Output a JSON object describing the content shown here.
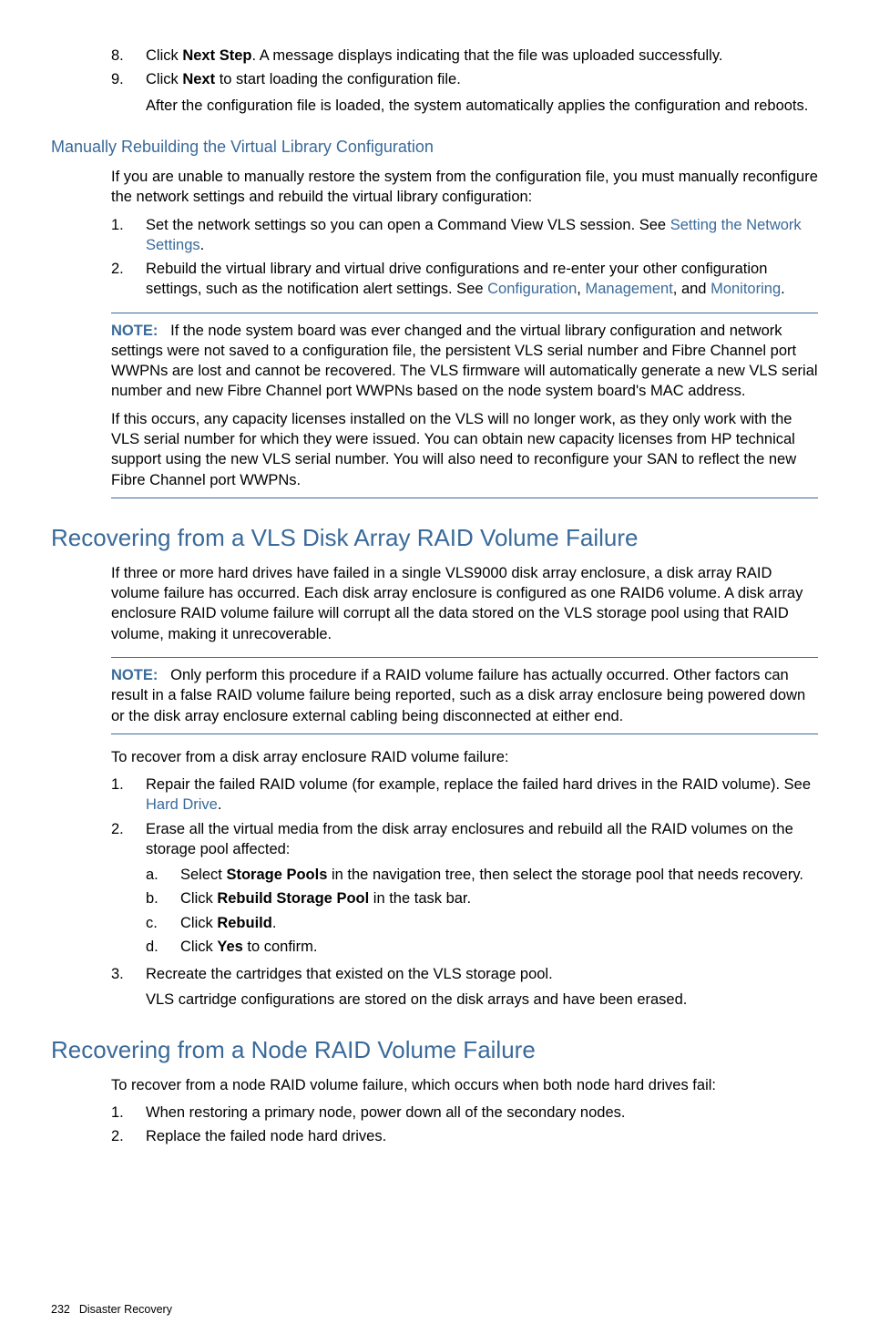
{
  "intro": {
    "step8": {
      "num": "8.",
      "text_pre": "Click ",
      "bold": "Next Step",
      "text_post": ". A message displays indicating that the file was uploaded successfully."
    },
    "step9": {
      "num": "9.",
      "text_pre": "Click ",
      "bold": "Next",
      "text_post": " to start loading the configuration file.",
      "after": "After the configuration file is loaded, the system automatically applies the configuration and reboots."
    }
  },
  "manual": {
    "heading": "Manually Rebuilding the Virtual Library Configuration",
    "intro": "If you are unable to manually restore the system from the configuration file, you must manually reconfigure the network settings and rebuild the virtual library configuration:",
    "step1": {
      "num": "1.",
      "pre": "Set the network settings so you can open a Command View VLS session. See ",
      "link": "Setting the Network Settings",
      "post": "."
    },
    "step2": {
      "num": "2.",
      "pre": "Rebuild the virtual library and virtual drive configurations and re-enter your other configuration settings, such as the notification alert settings. See ",
      "link1": "Configuration",
      "sep1": ", ",
      "link2": "Management",
      "sep2": ", and ",
      "link3": "Monitoring",
      "post": "."
    },
    "note_label": "NOTE:",
    "note1": "If the node system board was ever changed and the virtual library configuration and network settings were not saved to a configuration file, the persistent VLS serial number and Fibre Channel port WWPNs are lost and cannot be recovered. The VLS firmware will automatically generate a new VLS serial number and new Fibre Channel port WWPNs based on the node system board's MAC address.",
    "note2": "If this occurs, any capacity licenses installed on the VLS will no longer work, as they only work with the VLS serial number for which they were issued. You can obtain new capacity licenses from HP technical support using the new VLS serial number. You will also need to reconfigure your SAN to reflect the new Fibre Channel port WWPNs."
  },
  "disk": {
    "heading": "Recovering from a VLS Disk Array RAID Volume Failure",
    "intro": "If three or more hard drives have failed in a single VLS9000 disk array enclosure, a disk array RAID volume failure has occurred. Each disk array enclosure is configured as one RAID6 volume. A disk array enclosure RAID volume failure will corrupt all the data stored on the VLS storage pool using that RAID volume, making it unrecoverable.",
    "note_label": "NOTE:",
    "note": "Only perform this procedure if a RAID volume failure has actually occurred. Other factors can result in a false RAID volume failure being reported, such as a disk array enclosure being powered down or the disk array enclosure external cabling being disconnected at either end.",
    "lead": "To recover from a disk array enclosure RAID volume failure:",
    "step1": {
      "num": "1.",
      "pre": "Repair the failed RAID volume (for example, replace the failed hard drives in the RAID volume). See ",
      "link": "Hard Drive",
      "post": "."
    },
    "step2": {
      "num": "2.",
      "text": "Erase all the virtual media from the disk array enclosures and rebuild all the RAID volumes on the storage pool affected:",
      "a": {
        "num": "a.",
        "pre": "Select ",
        "bold": "Storage Pools",
        "post": " in the navigation tree, then select the storage pool that needs recovery."
      },
      "b": {
        "num": "b.",
        "pre": "Click ",
        "bold": "Rebuild Storage Pool",
        "post": " in the task bar."
      },
      "c": {
        "num": "c.",
        "pre": "Click ",
        "bold": "Rebuild",
        "post": "."
      },
      "d": {
        "num": "d.",
        "pre": "Click ",
        "bold": "Yes",
        "post": " to confirm."
      }
    },
    "step3": {
      "num": "3.",
      "text": "Recreate the cartridges that existed on the VLS storage pool.",
      "after": "VLS cartridge configurations are stored on the disk arrays and have been erased."
    }
  },
  "node": {
    "heading": "Recovering from a Node RAID Volume Failure",
    "intro": "To recover from a node RAID volume failure, which occurs when both node hard drives fail:",
    "step1": {
      "num": "1.",
      "text": "When restoring a primary node, power down all of the secondary nodes."
    },
    "step2": {
      "num": "2.",
      "text": "Replace the failed node hard drives."
    }
  },
  "footer": {
    "page": "232",
    "title": "Disaster Recovery"
  }
}
